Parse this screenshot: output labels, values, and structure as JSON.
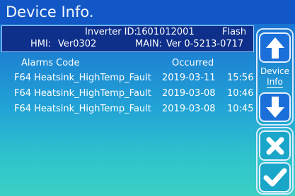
{
  "title": "Device Info.",
  "header": {
    "inverter_id_label": "Inverter ID:",
    "inverter_id_value": "1601012001",
    "flash_label": "Flash",
    "hmi_label": "HMI:",
    "hmi_value": "Ver0302",
    "main_label": "MAIN:",
    "main_value": "Ver 0-5213-0717"
  },
  "alarms": {
    "columns": [
      "Alarms Code",
      "Occurred"
    ],
    "rows": [
      {
        "code": "F64 Heatsink_HighTemp_Fault",
        "date": "2019-03-11",
        "time": "15:56"
      },
      {
        "code": "F64 Heatsink_HighTemp_Fault",
        "date": "2019-03-08",
        "time": "10:46"
      },
      {
        "code": "F64 Heatsink_HighTemp_Fault",
        "date": "2019-03-08",
        "time": "10:45"
      }
    ]
  },
  "side_buttons": {
    "device_line1": "Device",
    "device_line2": "Info",
    "up_icon": "arrow-up-icon",
    "down_icon": "arrow-down-icon",
    "cancel_icon": "close-icon",
    "ok_icon": "check-icon"
  },
  "colors": {
    "title_bar": "#1257c6",
    "header_panel": "#0e2f8a",
    "button_blue": "#1a6fd8",
    "button_teal": "#1aa6c8"
  }
}
